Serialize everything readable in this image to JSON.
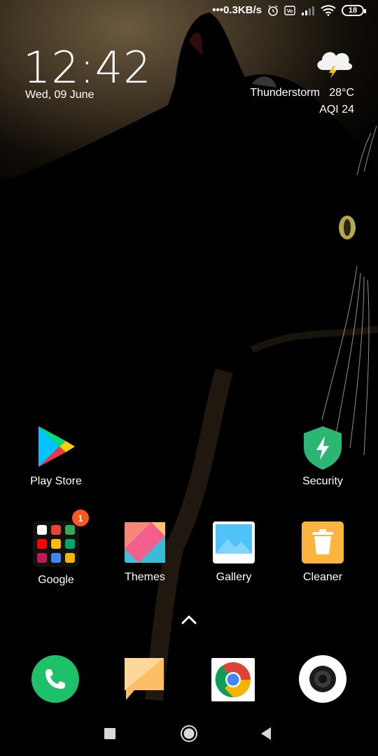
{
  "status_bar": {
    "network_speed": "0.3KB/s",
    "battery": "18"
  },
  "clock": {
    "time": "12:42",
    "date": "Wed, 09 June"
  },
  "weather": {
    "condition": "Thunderstorm",
    "temperature": "28°C",
    "aqi": "AQI 24",
    "icon": "thunderstorm-icon"
  },
  "apps_row1": [
    {
      "label": "Play Store",
      "icon": "play-store-icon"
    },
    {
      "label": "Security",
      "icon": "security-shield-icon"
    }
  ],
  "apps_row2": [
    {
      "label": "Google",
      "icon": "google-folder-icon",
      "badge": "1"
    },
    {
      "label": "Themes",
      "icon": "themes-icon"
    },
    {
      "label": "Gallery",
      "icon": "gallery-icon"
    },
    {
      "label": "Cleaner",
      "icon": "cleaner-icon"
    }
  ],
  "dock": [
    {
      "icon": "phone-icon"
    },
    {
      "icon": "messages-icon"
    },
    {
      "icon": "chrome-icon"
    },
    {
      "icon": "camera-icon"
    }
  ],
  "colors": {
    "phone": "#1ec06a",
    "security": "#2bb673",
    "badge": "#ff5722"
  }
}
